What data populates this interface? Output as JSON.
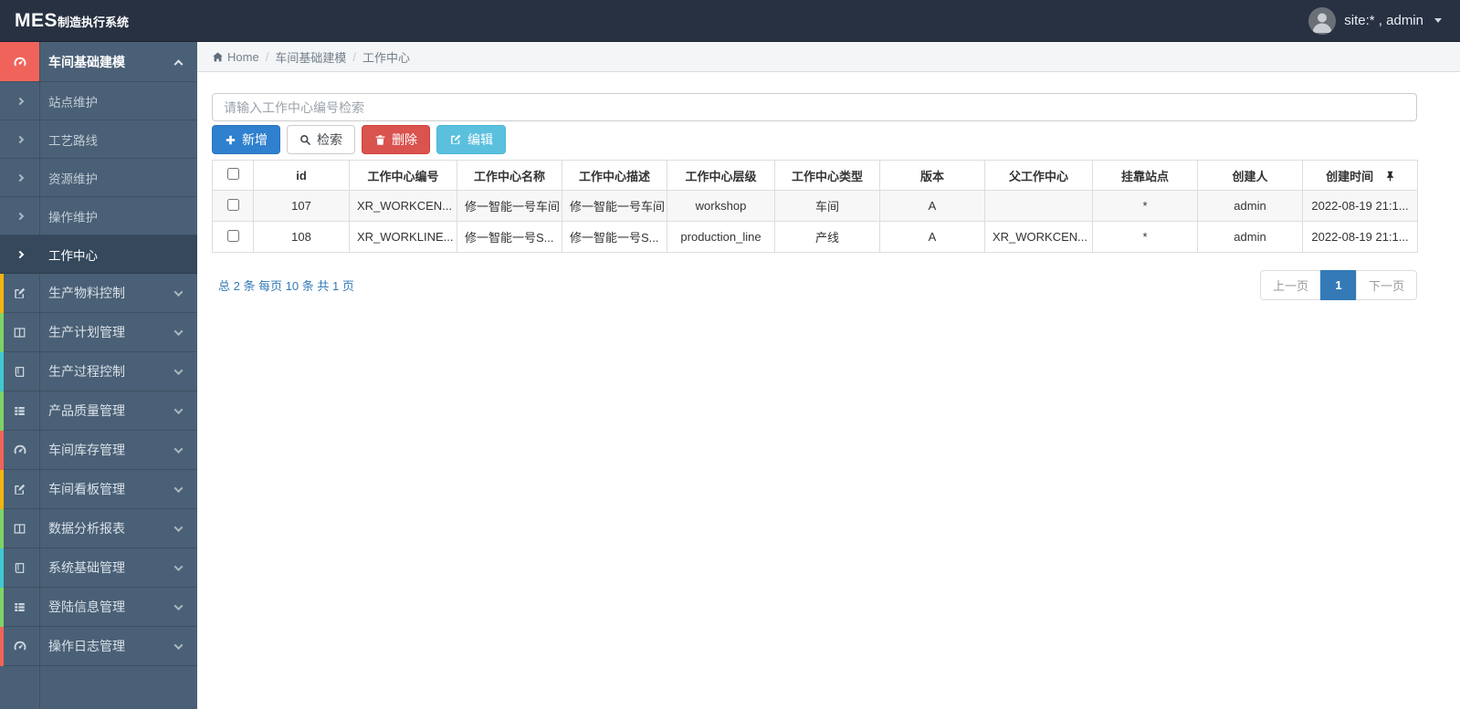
{
  "topbar": {
    "brand_bold": "MES",
    "brand_rest": "制造执行系统",
    "user": "site:* , admin"
  },
  "breadcrumb": {
    "home": "Home",
    "separator": "/",
    "crumbs": [
      "车间基础建模",
      "工作中心"
    ]
  },
  "sidebar": {
    "group": {
      "label": "车间基础建模",
      "children": [
        "站点维护",
        "工艺路线",
        "资源维护",
        "操作维护",
        "工作中心"
      ],
      "active_child": "工作中心"
    },
    "items": [
      {
        "label": "生产物料控制",
        "accent": "#f3b40f"
      },
      {
        "label": "生产计划管理",
        "accent": "#7fd364"
      },
      {
        "label": "生产过程控制",
        "accent": "#3fc8d2"
      },
      {
        "label": "产品质量管理",
        "accent": "#7fd364"
      },
      {
        "label": "车间库存管理",
        "accent": "#ef6459"
      },
      {
        "label": "车间看板管理",
        "accent": "#f3b40f"
      },
      {
        "label": "数据分析报表",
        "accent": "#7fd364"
      },
      {
        "label": "系统基础管理",
        "accent": "#3fc8d2"
      },
      {
        "label": "登陆信息管理",
        "accent": "#7fd364"
      },
      {
        "label": "操作日志管理",
        "accent": "#ef6459"
      }
    ]
  },
  "search": {
    "placeholder": "请输入工作中心编号检索"
  },
  "toolbar": {
    "add": "新增",
    "search": "检索",
    "delete": "删除",
    "edit": "编辑"
  },
  "table": {
    "columns": [
      "id",
      "工作中心编号",
      "工作中心名称",
      "工作中心描述",
      "工作中心层级",
      "工作中心类型",
      "版本",
      "父工作中心",
      "挂靠站点",
      "创建人",
      "创建时间"
    ],
    "rows": [
      [
        "107",
        "XR_WORKCEN...",
        "修一智能一号车间",
        "修一智能一号车间",
        "workshop",
        "车间",
        "A",
        "",
        "*",
        "admin",
        "2022-08-19 21:1..."
      ],
      [
        "108",
        "XR_WORKLINE...",
        "修一智能一号S...",
        "修一智能一号S...",
        "production_line",
        "产线",
        "A",
        "XR_WORKCEN...",
        "*",
        "admin",
        "2022-08-19 21:1..."
      ]
    ]
  },
  "pagination": {
    "summary": "总 2 条 每页 10 条 共 1 页",
    "prev": "上一页",
    "page": "1",
    "next": "下一页"
  },
  "colors": {
    "topbar_bg": "#273142",
    "sidebar_bg": "#4a6076",
    "sidebar_active_bg": "#35485c",
    "group_icon_bg": "#f0635a",
    "primary_button": "#2f80ce",
    "danger_button": "#d9534f",
    "info_button": "#5bc0de",
    "link_blue": "#337ab7"
  }
}
